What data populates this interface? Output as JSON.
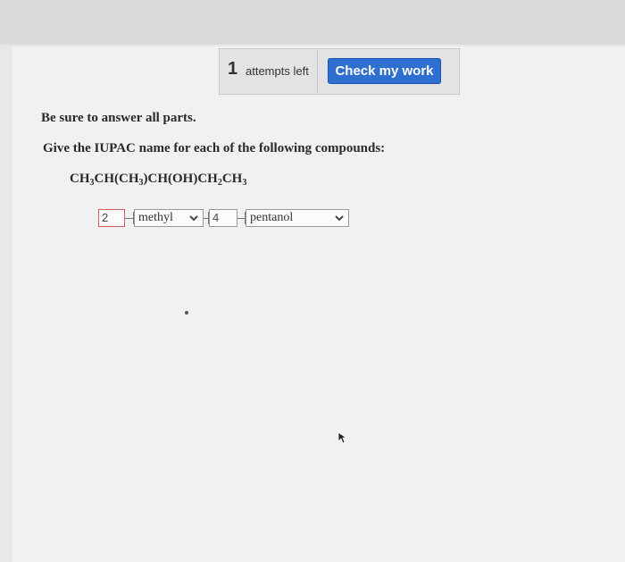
{
  "header": {
    "attempts_count": "1",
    "attempts_label": "attempts left",
    "check_button": "Check my work"
  },
  "content": {
    "instruction": "Be sure to answer all parts.",
    "question": "Give the IUPAC name for each of the following compounds:",
    "formula_parts": [
      "CH",
      "3",
      "CH(CH",
      "3",
      ")CH(OH)CH",
      "2",
      "CH",
      "3"
    ]
  },
  "answer": {
    "locant1": "2",
    "substituent": "methyl",
    "locant2": "4",
    "parent": "pentanol"
  },
  "colors": {
    "accent": "#2e6fd0",
    "invalid_border": "#d06060"
  }
}
